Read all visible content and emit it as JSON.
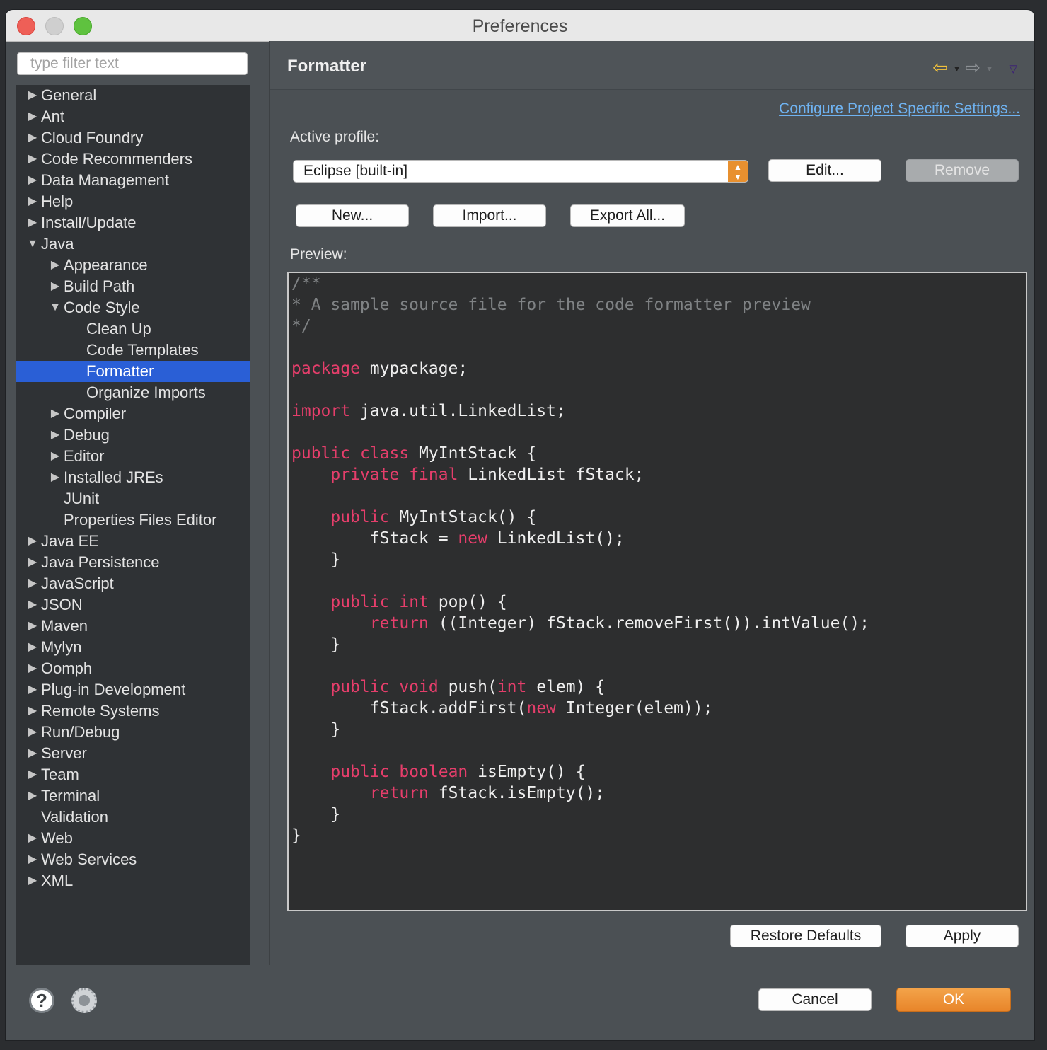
{
  "window": {
    "title": "Preferences",
    "controls": {
      "close_color": "#ee5f57",
      "minimize_color": "#cfcfcf",
      "zoom_color": "#5fc23f"
    }
  },
  "filter": {
    "placeholder": "type filter text",
    "value": ""
  },
  "tree": {
    "items": [
      {
        "label": "General",
        "level": 0,
        "state": "collapsed"
      },
      {
        "label": "Ant",
        "level": 0,
        "state": "collapsed"
      },
      {
        "label": "Cloud Foundry",
        "level": 0,
        "state": "collapsed"
      },
      {
        "label": "Code Recommenders",
        "level": 0,
        "state": "collapsed"
      },
      {
        "label": "Data Management",
        "level": 0,
        "state": "collapsed"
      },
      {
        "label": "Help",
        "level": 0,
        "state": "collapsed"
      },
      {
        "label": "Install/Update",
        "level": 0,
        "state": "collapsed"
      },
      {
        "label": "Java",
        "level": 0,
        "state": "expanded"
      },
      {
        "label": "Appearance",
        "level": 1,
        "state": "collapsed"
      },
      {
        "label": "Build Path",
        "level": 1,
        "state": "collapsed"
      },
      {
        "label": "Code Style",
        "level": 1,
        "state": "expanded"
      },
      {
        "label": "Clean Up",
        "level": 2,
        "state": "leaf"
      },
      {
        "label": "Code Templates",
        "level": 2,
        "state": "leaf"
      },
      {
        "label": "Formatter",
        "level": 2,
        "state": "leaf",
        "selected": true
      },
      {
        "label": "Organize Imports",
        "level": 2,
        "state": "leaf"
      },
      {
        "label": "Compiler",
        "level": 1,
        "state": "collapsed"
      },
      {
        "label": "Debug",
        "level": 1,
        "state": "collapsed"
      },
      {
        "label": "Editor",
        "level": 1,
        "state": "collapsed"
      },
      {
        "label": "Installed JREs",
        "level": 1,
        "state": "collapsed"
      },
      {
        "label": "JUnit",
        "level": 1,
        "state": "leaf"
      },
      {
        "label": "Properties Files Editor",
        "level": 1,
        "state": "leaf"
      },
      {
        "label": "Java EE",
        "level": 0,
        "state": "collapsed"
      },
      {
        "label": "Java Persistence",
        "level": 0,
        "state": "collapsed"
      },
      {
        "label": "JavaScript",
        "level": 0,
        "state": "collapsed"
      },
      {
        "label": "JSON",
        "level": 0,
        "state": "collapsed"
      },
      {
        "label": "Maven",
        "level": 0,
        "state": "collapsed"
      },
      {
        "label": "Mylyn",
        "level": 0,
        "state": "collapsed"
      },
      {
        "label": "Oomph",
        "level": 0,
        "state": "collapsed"
      },
      {
        "label": "Plug-in Development",
        "level": 0,
        "state": "collapsed"
      },
      {
        "label": "Remote Systems",
        "level": 0,
        "state": "collapsed"
      },
      {
        "label": "Run/Debug",
        "level": 0,
        "state": "collapsed"
      },
      {
        "label": "Server",
        "level": 0,
        "state": "collapsed"
      },
      {
        "label": "Team",
        "level": 0,
        "state": "collapsed"
      },
      {
        "label": "Terminal",
        "level": 0,
        "state": "collapsed"
      },
      {
        "label": "Validation",
        "level": 0,
        "state": "leaf"
      },
      {
        "label": "Web",
        "level": 0,
        "state": "collapsed"
      },
      {
        "label": "Web Services",
        "level": 0,
        "state": "collapsed"
      },
      {
        "label": "XML",
        "level": 0,
        "state": "collapsed"
      }
    ]
  },
  "page": {
    "title": "Formatter",
    "nav": {
      "back_icon": "back-arrow-icon",
      "forward_icon": "forward-arrow-icon",
      "menu_icon": "view-menu-icon"
    },
    "configure_link": "Configure Project Specific Settings...",
    "active_profile_label": "Active profile:",
    "active_profile_value": "Eclipse [built-in]",
    "edit_label": "Edit...",
    "remove_label": "Remove",
    "new_label": "New...",
    "import_label": "Import...",
    "export_label": "Export All...",
    "preview_label": "Preview:",
    "preview_code": [
      [
        {
          "t": "/**",
          "c": "cm"
        }
      ],
      [
        {
          "t": "* A sample source file for the code formatter preview",
          "c": "cm"
        }
      ],
      [
        {
          "t": "*/",
          "c": "cm"
        }
      ],
      [],
      [
        {
          "t": "package",
          "c": "kw"
        },
        {
          "t": " mypackage;"
        }
      ],
      [],
      [
        {
          "t": "import",
          "c": "kw"
        },
        {
          "t": " java.util.LinkedList;"
        }
      ],
      [],
      [
        {
          "t": "public",
          "c": "kw"
        },
        {
          "t": " "
        },
        {
          "t": "class",
          "c": "kw"
        },
        {
          "t": " MyIntStack {"
        }
      ],
      [
        {
          "t": "    "
        },
        {
          "t": "private",
          "c": "kw"
        },
        {
          "t": " "
        },
        {
          "t": "final",
          "c": "kw"
        },
        {
          "t": " LinkedList fStack;"
        }
      ],
      [],
      [
        {
          "t": "    "
        },
        {
          "t": "public",
          "c": "kw"
        },
        {
          "t": " MyIntStack() {"
        }
      ],
      [
        {
          "t": "        fStack = "
        },
        {
          "t": "new",
          "c": "kw"
        },
        {
          "t": " LinkedList();"
        }
      ],
      [
        {
          "t": "    }"
        }
      ],
      [],
      [
        {
          "t": "    "
        },
        {
          "t": "public",
          "c": "kw"
        },
        {
          "t": " "
        },
        {
          "t": "int",
          "c": "kw"
        },
        {
          "t": " pop() {"
        }
      ],
      [
        {
          "t": "        "
        },
        {
          "t": "return",
          "c": "kw"
        },
        {
          "t": " ((Integer) fStack.removeFirst()).intValue();"
        }
      ],
      [
        {
          "t": "    }"
        }
      ],
      [],
      [
        {
          "t": "    "
        },
        {
          "t": "public",
          "c": "kw"
        },
        {
          "t": " "
        },
        {
          "t": "void",
          "c": "kw"
        },
        {
          "t": " push("
        },
        {
          "t": "int",
          "c": "kw"
        },
        {
          "t": " elem) {"
        }
      ],
      [
        {
          "t": "        fStack.addFirst("
        },
        {
          "t": "new",
          "c": "kw"
        },
        {
          "t": " Integer(elem));"
        }
      ],
      [
        {
          "t": "    }"
        }
      ],
      [],
      [
        {
          "t": "    "
        },
        {
          "t": "public",
          "c": "kw"
        },
        {
          "t": " "
        },
        {
          "t": "boolean",
          "c": "kw"
        },
        {
          "t": " isEmpty() {"
        }
      ],
      [
        {
          "t": "        "
        },
        {
          "t": "return",
          "c": "kw"
        },
        {
          "t": " fStack.isEmpty();"
        }
      ],
      [
        {
          "t": "    }"
        }
      ],
      [
        {
          "t": "}"
        }
      ]
    ],
    "restore_defaults_label": "Restore Defaults",
    "apply_label": "Apply"
  },
  "footer": {
    "help_icon": "help-icon",
    "import_export_icon": "import-export-icon",
    "cancel_label": "Cancel",
    "ok_label": "OK"
  },
  "colors": {
    "selection": "#2a5fd6",
    "accent_orange": "#e8852a",
    "keyword": "#e53e6b",
    "comment": "#7f8284",
    "link": "#6fb3f2"
  }
}
